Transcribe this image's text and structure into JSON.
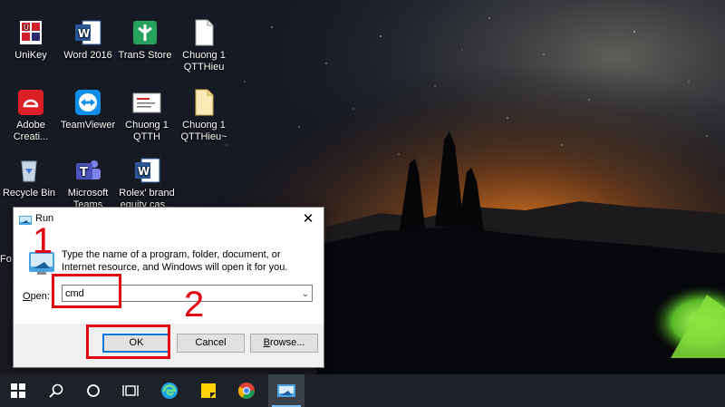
{
  "desktop": {
    "icons": [
      {
        "label_1": "UniKey",
        "label_2": "",
        "icon": "unikey-icon"
      },
      {
        "label_1": "Word 2016",
        "label_2": "",
        "icon": "word-icon"
      },
      {
        "label_1": "TranS Store",
        "label_2": "",
        "icon": "transstore-icon"
      },
      {
        "label_1": "Chuong 1",
        "label_2": "QTTHieu",
        "icon": "document-icon"
      },
      {
        "label_1": "Adobe",
        "label_2": "Creati...",
        "icon": "adobe-creative-cloud-icon"
      },
      {
        "label_1": "TeamViewer",
        "label_2": "",
        "icon": "teamviewer-icon"
      },
      {
        "label_1": "Chuong 1",
        "label_2": "QTTH",
        "icon": "slide-thumbnail-icon"
      },
      {
        "label_1": "Chuong 1",
        "label_2": "QTTHieu~",
        "icon": "document-icon"
      },
      {
        "label_1": "Recycle Bin",
        "label_2": "",
        "icon": "recycle-bin-icon"
      },
      {
        "label_1": "Microsoft",
        "label_2": "Teams",
        "icon": "teams-icon"
      },
      {
        "label_1": "Rolex' brand",
        "label_2": "equity cas...",
        "icon": "word-doc-icon"
      }
    ],
    "partial_label": "Fo"
  },
  "run_dialog": {
    "title": "Run",
    "close_glyph": "✕",
    "description": "Type the name of a program, folder, document, or Internet resource, and Windows will open it for you.",
    "open_label_first": "O",
    "open_label_rest": "pen:",
    "open_value": "cmd",
    "dropdown_glyph": "⌄",
    "ok_label": "OK",
    "cancel_label": "Cancel",
    "browse_label_first": "B",
    "browse_label_rest": "rowse..."
  },
  "annotations": {
    "step1": "1",
    "step2": "2",
    "color": "#e3000f"
  },
  "taskbar": {
    "items": [
      "start-icon",
      "search-icon",
      "cortana-icon",
      "task-view-icon",
      "edge-icon",
      "sticky-notes-icon",
      "chrome-icon",
      "run-app-icon"
    ],
    "active_item": "run-app-icon"
  }
}
